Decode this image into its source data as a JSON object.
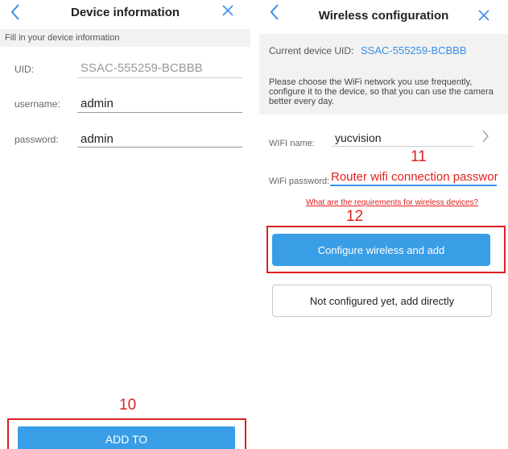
{
  "left": {
    "title": "Device information",
    "hint": "Fill in your device information",
    "fields": [
      {
        "label": "UID:",
        "value": "SSAC-555259-BCBBB"
      },
      {
        "label": "username:",
        "value": "admin"
      },
      {
        "label": "password:",
        "value": "admin"
      }
    ],
    "step_label": "10",
    "add_button": "ADD TO"
  },
  "right": {
    "title": "Wireless configuration",
    "uid_label": "Current device UID:",
    "uid_value": "SSAC-555259-BCBBB",
    "description": "Please choose the WiFi network you use frequently, configure it to the device, so that you can use the camera better every day.",
    "wifi_name_label": "WIFI name:",
    "wifi_name_value": "yucvision",
    "step_11": "11",
    "wifi_password_label": "WiFi password:",
    "wifi_password_value": "Router wifi connection passwor",
    "requirements_link": "What are the requirements for wireless devices?",
    "step_12": "12",
    "configure_button": "Configure wireless and add",
    "not_configured_button": "Not configured yet, add directly"
  },
  "icons": {
    "back": "chevron-left-icon",
    "close": "close-icon",
    "chevron_right": "chevron-right-icon"
  },
  "colors": {
    "accent": "#3a9ee6",
    "annotation_red": "#e02020"
  }
}
